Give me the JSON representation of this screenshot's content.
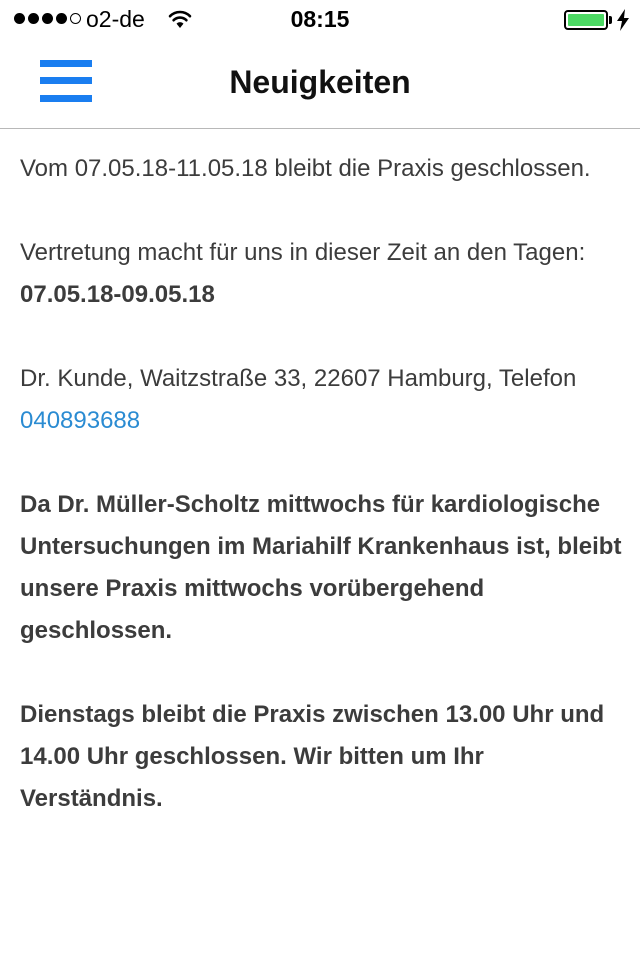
{
  "status_bar": {
    "carrier": "o2-de",
    "time": "08:15",
    "signal_bars_filled": 4,
    "signal_bars_total": 5,
    "battery_level": 1.0
  },
  "nav": {
    "title": "Neuigkeiten",
    "menu_icon": "hamburger-menu-icon",
    "accent_color": "#1a7ef0"
  },
  "content": {
    "p1": "Vom  07.05.18-11.05.18 bleibt die Praxis geschlossen.",
    "p2_text": "Vertretung macht für uns in dieser Zeit an den Tagen:",
    "p2_bold": "07.05.18-09.05.18",
    "p3_text": "Dr. Kunde, Waitzstraße 33, 22607 Hamburg, Telefon",
    "p3_phone": "040893688",
    "p4": "Da Dr. Müller-Scholtz mittwochs für kardiologische Untersuchungen im Mariahilf Krankenhaus ist, bleibt unsere Praxis mittwochs vorübergehend geschlossen.",
    "p5": "Dienstags bleibt die Praxis zwischen 13.00 Uhr und 14.00 Uhr geschlossen. Wir bitten um Ihr Verständnis.",
    "link_color": "#2a8bd2"
  }
}
